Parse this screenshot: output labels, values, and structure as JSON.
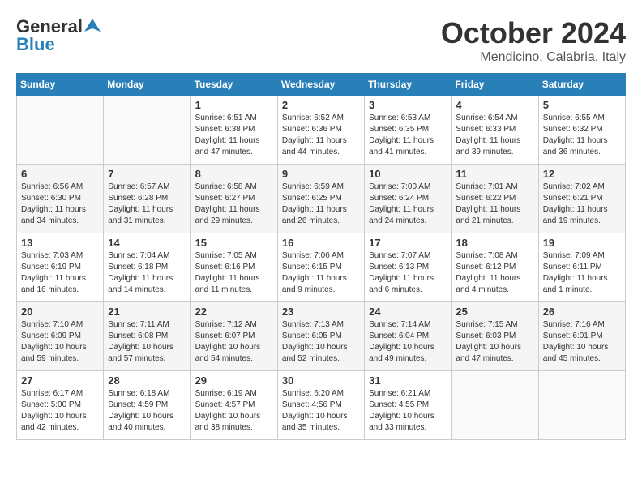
{
  "header": {
    "logo_line1": "General",
    "logo_line2": "Blue",
    "month": "October 2024",
    "location": "Mendicino, Calabria, Italy"
  },
  "days_of_week": [
    "Sunday",
    "Monday",
    "Tuesday",
    "Wednesday",
    "Thursday",
    "Friday",
    "Saturday"
  ],
  "weeks": [
    [
      {
        "day": "",
        "info": ""
      },
      {
        "day": "",
        "info": ""
      },
      {
        "day": "1",
        "info": "Sunrise: 6:51 AM\nSunset: 6:38 PM\nDaylight: 11 hours and 47 minutes."
      },
      {
        "day": "2",
        "info": "Sunrise: 6:52 AM\nSunset: 6:36 PM\nDaylight: 11 hours and 44 minutes."
      },
      {
        "day": "3",
        "info": "Sunrise: 6:53 AM\nSunset: 6:35 PM\nDaylight: 11 hours and 41 minutes."
      },
      {
        "day": "4",
        "info": "Sunrise: 6:54 AM\nSunset: 6:33 PM\nDaylight: 11 hours and 39 minutes."
      },
      {
        "day": "5",
        "info": "Sunrise: 6:55 AM\nSunset: 6:32 PM\nDaylight: 11 hours and 36 minutes."
      }
    ],
    [
      {
        "day": "6",
        "info": "Sunrise: 6:56 AM\nSunset: 6:30 PM\nDaylight: 11 hours and 34 minutes."
      },
      {
        "day": "7",
        "info": "Sunrise: 6:57 AM\nSunset: 6:28 PM\nDaylight: 11 hours and 31 minutes."
      },
      {
        "day": "8",
        "info": "Sunrise: 6:58 AM\nSunset: 6:27 PM\nDaylight: 11 hours and 29 minutes."
      },
      {
        "day": "9",
        "info": "Sunrise: 6:59 AM\nSunset: 6:25 PM\nDaylight: 11 hours and 26 minutes."
      },
      {
        "day": "10",
        "info": "Sunrise: 7:00 AM\nSunset: 6:24 PM\nDaylight: 11 hours and 24 minutes."
      },
      {
        "day": "11",
        "info": "Sunrise: 7:01 AM\nSunset: 6:22 PM\nDaylight: 11 hours and 21 minutes."
      },
      {
        "day": "12",
        "info": "Sunrise: 7:02 AM\nSunset: 6:21 PM\nDaylight: 11 hours and 19 minutes."
      }
    ],
    [
      {
        "day": "13",
        "info": "Sunrise: 7:03 AM\nSunset: 6:19 PM\nDaylight: 11 hours and 16 minutes."
      },
      {
        "day": "14",
        "info": "Sunrise: 7:04 AM\nSunset: 6:18 PM\nDaylight: 11 hours and 14 minutes."
      },
      {
        "day": "15",
        "info": "Sunrise: 7:05 AM\nSunset: 6:16 PM\nDaylight: 11 hours and 11 minutes."
      },
      {
        "day": "16",
        "info": "Sunrise: 7:06 AM\nSunset: 6:15 PM\nDaylight: 11 hours and 9 minutes."
      },
      {
        "day": "17",
        "info": "Sunrise: 7:07 AM\nSunset: 6:13 PM\nDaylight: 11 hours and 6 minutes."
      },
      {
        "day": "18",
        "info": "Sunrise: 7:08 AM\nSunset: 6:12 PM\nDaylight: 11 hours and 4 minutes."
      },
      {
        "day": "19",
        "info": "Sunrise: 7:09 AM\nSunset: 6:11 PM\nDaylight: 11 hours and 1 minute."
      }
    ],
    [
      {
        "day": "20",
        "info": "Sunrise: 7:10 AM\nSunset: 6:09 PM\nDaylight: 10 hours and 59 minutes."
      },
      {
        "day": "21",
        "info": "Sunrise: 7:11 AM\nSunset: 6:08 PM\nDaylight: 10 hours and 57 minutes."
      },
      {
        "day": "22",
        "info": "Sunrise: 7:12 AM\nSunset: 6:07 PM\nDaylight: 10 hours and 54 minutes."
      },
      {
        "day": "23",
        "info": "Sunrise: 7:13 AM\nSunset: 6:05 PM\nDaylight: 10 hours and 52 minutes."
      },
      {
        "day": "24",
        "info": "Sunrise: 7:14 AM\nSunset: 6:04 PM\nDaylight: 10 hours and 49 minutes."
      },
      {
        "day": "25",
        "info": "Sunrise: 7:15 AM\nSunset: 6:03 PM\nDaylight: 10 hours and 47 minutes."
      },
      {
        "day": "26",
        "info": "Sunrise: 7:16 AM\nSunset: 6:01 PM\nDaylight: 10 hours and 45 minutes."
      }
    ],
    [
      {
        "day": "27",
        "info": "Sunrise: 6:17 AM\nSunset: 5:00 PM\nDaylight: 10 hours and 42 minutes."
      },
      {
        "day": "28",
        "info": "Sunrise: 6:18 AM\nSunset: 4:59 PM\nDaylight: 10 hours and 40 minutes."
      },
      {
        "day": "29",
        "info": "Sunrise: 6:19 AM\nSunset: 4:57 PM\nDaylight: 10 hours and 38 minutes."
      },
      {
        "day": "30",
        "info": "Sunrise: 6:20 AM\nSunset: 4:56 PM\nDaylight: 10 hours and 35 minutes."
      },
      {
        "day": "31",
        "info": "Sunrise: 6:21 AM\nSunset: 4:55 PM\nDaylight: 10 hours and 33 minutes."
      },
      {
        "day": "",
        "info": ""
      },
      {
        "day": "",
        "info": ""
      }
    ]
  ]
}
